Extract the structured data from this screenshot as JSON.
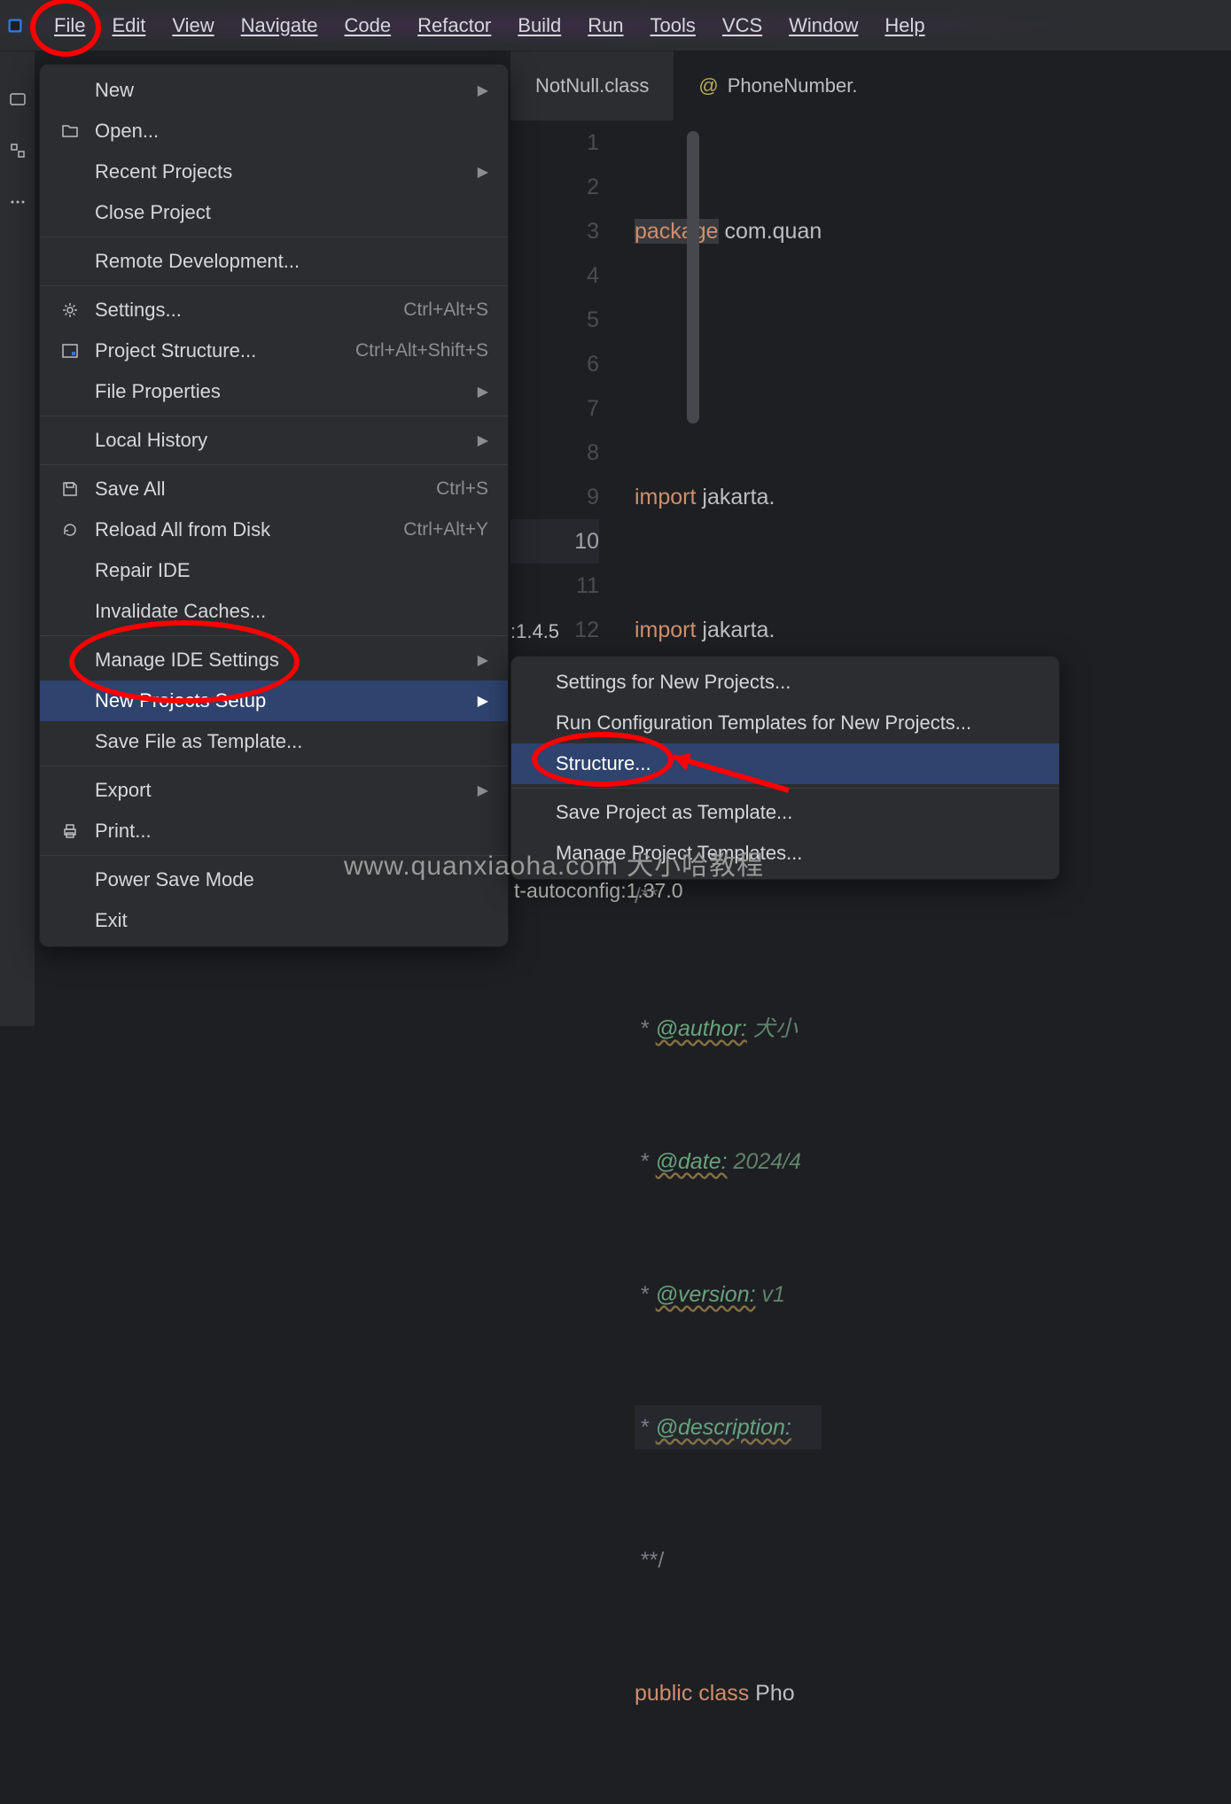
{
  "menubar": {
    "file": "File",
    "edit": "Edit",
    "view": "View",
    "navigate": "Navigate",
    "code": "Code",
    "refactor": "Refactor",
    "build": "Build",
    "run": "Run",
    "tools": "Tools",
    "vcs": "VCS",
    "window": "Window",
    "help": "Help"
  },
  "tabs": {
    "tab1": "NotNull.class",
    "tab2": "PhoneNumber."
  },
  "file_menu": {
    "new": "New",
    "open": "Open...",
    "recent": "Recent Projects",
    "close": "Close Project",
    "remote": "Remote Development...",
    "settings": "Settings...",
    "settings_sc": "Ctrl+Alt+S",
    "project_structure": "Project Structure...",
    "project_structure_sc": "Ctrl+Alt+Shift+S",
    "file_props": "File Properties",
    "local_history": "Local History",
    "save_all": "Save All",
    "save_all_sc": "Ctrl+S",
    "reload": "Reload All from Disk",
    "reload_sc": "Ctrl+Alt+Y",
    "repair": "Repair IDE",
    "invalidate": "Invalidate Caches...",
    "manage_ide": "Manage IDE Settings",
    "new_projects_setup": "New Projects Setup",
    "save_template": "Save File as Template...",
    "export": "Export",
    "print": "Print...",
    "power_save": "Power Save Mode",
    "exit": "Exit"
  },
  "submenu": {
    "settings_np": "Settings for New Projects...",
    "run_cfg": "Run Configuration Templates for New Projects...",
    "structure": "Structure...",
    "save_proj": "Save Project as Template...",
    "manage_proj": "Manage Project Templates..."
  },
  "code": {
    "line1a": "package",
    "line1b": " com.quan",
    "line3a": "import",
    "line3b": " jakarta.",
    "line4a": "import",
    "line4b": " jakarta.",
    "line6": "/**",
    "line7t": "@author:",
    "line7v": " 犬小",
    "line8t": "@date:",
    "line8v": " 2024/4",
    "line9t": "@version:",
    "line9v": " v1",
    "line10t": "@description:",
    "line11": " **/",
    "line12a": "public ",
    "line12b": "class",
    "line12c": " Pho"
  },
  "gutter": [
    "1",
    "2",
    "3",
    "4",
    "5",
    "6",
    "7",
    "8",
    "9",
    "10",
    "11",
    "12"
  ],
  "version_fragment": ":1.4.5",
  "watermark": "www.quanxiaoha.com 犬小哈教程",
  "watermark2": "t-autoconfig:1.37.0"
}
